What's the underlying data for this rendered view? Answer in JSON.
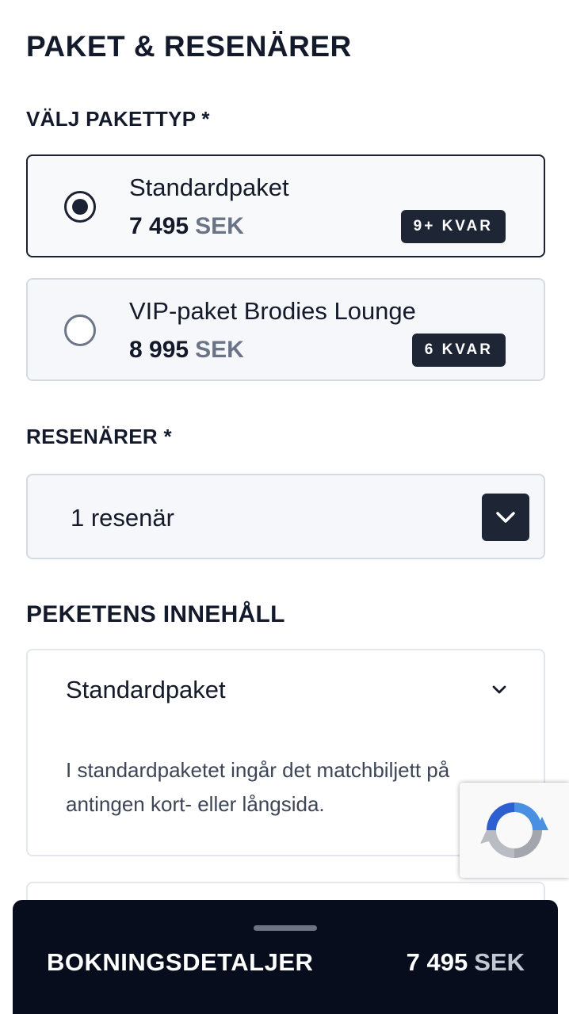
{
  "page": {
    "title": "PAKET & RESENÄRER"
  },
  "package_section": {
    "label": "VÄLJ PAKETTYP *",
    "options": [
      {
        "name": "Standardpaket",
        "price": "7 495",
        "currency": "SEK",
        "availability": "9+ KVAR",
        "selected": true
      },
      {
        "name": "VIP-paket Brodies Lounge",
        "price": "8 995",
        "currency": "SEK",
        "availability": "6 KVAR",
        "selected": false
      }
    ]
  },
  "travellers_section": {
    "label": "RESENÄRER *",
    "selected_value": "1 resenär",
    "toggle_icon": "chevron-down-icon"
  },
  "contents_section": {
    "label": "PEKETENS INNEHÅLL",
    "accordion": {
      "title": "Standardpaket",
      "body": "I standardpaketet ingår det matchbiljett på antingen kort- eller långsida."
    }
  },
  "bottom_bar": {
    "label": "BOKNINGSDETALJER",
    "total": "7 495",
    "currency": "SEK"
  },
  "colors": {
    "primary_dark": "#1e2535",
    "bar_bg": "#070d1c",
    "muted_text": "#6b7487"
  }
}
